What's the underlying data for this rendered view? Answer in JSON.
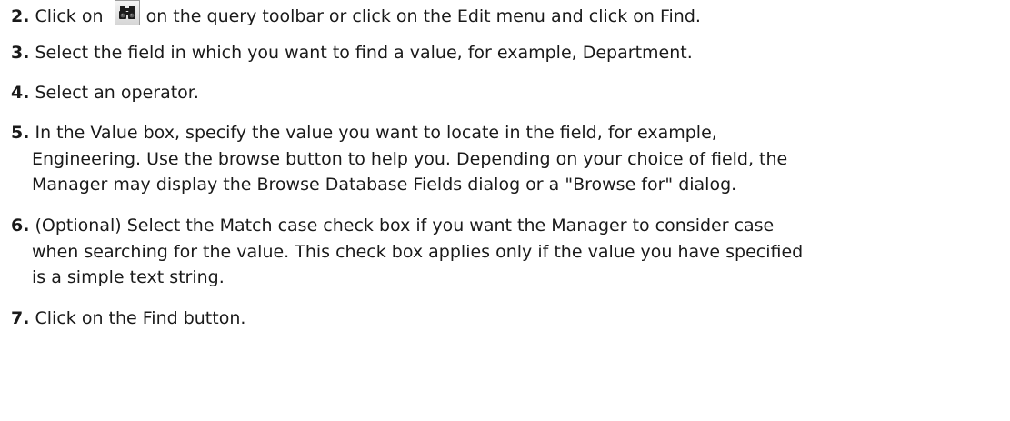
{
  "steps": [
    {
      "number": "2.",
      "before_icon": "Click on",
      "icon": "binoculars-icon",
      "after_icon": "on the query toolbar or click on the Edit menu and click on Find."
    },
    {
      "number": "3.",
      "text": "Select the field in which you want to find a value, for example, Department."
    },
    {
      "number": "4.",
      "text": "Select an operator."
    },
    {
      "number": "5.",
      "line1": "In the Value box, specify the value you want to locate in the field, for example,",
      "line2": "Engineering. Use the browse button to help you. Depending on your choice of field, the",
      "line3": "Manager may display the Browse Database Fields dialog or a \"Browse for\" dialog."
    },
    {
      "number": "6.",
      "line1": "(Optional) Select the Match case check box if you want the Manager to consider case",
      "line2": "when searching for the value. This check box applies only if the value you have specified",
      "line3": "is a simple text string."
    },
    {
      "number": "7.",
      "text": "Click on the Find button."
    }
  ]
}
